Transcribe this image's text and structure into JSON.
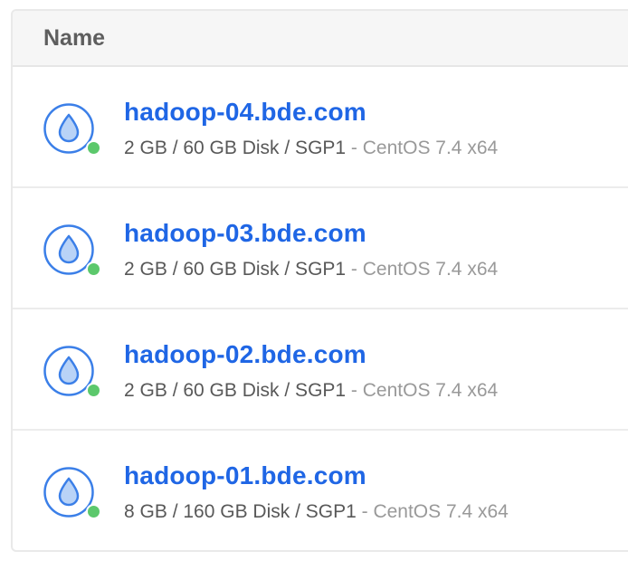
{
  "header": {
    "name_label": "Name"
  },
  "droplets": [
    {
      "name": "hadoop-04.bde.com",
      "specs": "2 GB / 60 GB Disk / SGP1",
      "os": " - CentOS 7.4 x64"
    },
    {
      "name": "hadoop-03.bde.com",
      "specs": "2 GB / 60 GB Disk / SGP1",
      "os": " - CentOS 7.4 x64"
    },
    {
      "name": "hadoop-02.bde.com",
      "specs": "2 GB / 60 GB Disk / SGP1",
      "os": " - CentOS 7.4 x64"
    },
    {
      "name": "hadoop-01.bde.com",
      "specs": "8 GB / 160 GB Disk / SGP1",
      "os": " - CentOS 7.4 x64"
    }
  ],
  "colors": {
    "link": "#1f66e5",
    "status_active": "#5cc86c",
    "icon_ring": "#3b7fe8",
    "icon_fill": "#b9d3f7"
  },
  "icons": {
    "droplet": "droplet-icon",
    "status": "status-active-dot"
  }
}
